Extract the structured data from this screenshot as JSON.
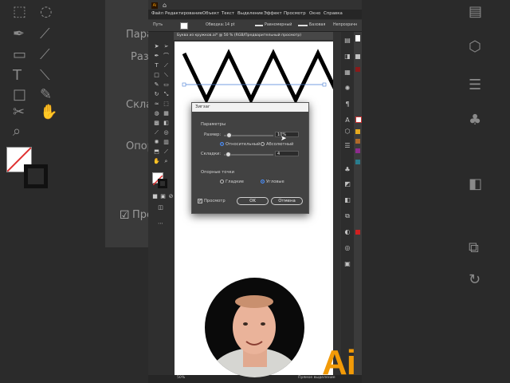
{
  "app": {
    "window_icon": "Ai"
  },
  "menubar": [
    "Файл",
    "Редактирование",
    "Объект",
    "Текст",
    "Выделение",
    "Эффект",
    "Просмотр",
    "Окно",
    "Справка"
  ],
  "control_bar": {
    "object_label": "Путь",
    "stroke_label": "Обводка:",
    "stroke_weight": "14 pt",
    "profile_label": "Равномерный",
    "brush_label": "Базовая",
    "opacity_label": "Непрозрачн"
  },
  "document_tab": "Буква из кружков.ai* @ 50 % (RGB/Предварительный просмотр)",
  "dialog": {
    "title": "Зигзаг",
    "params_label": "Параметры",
    "size_label": "Размер:",
    "size_value": "10%",
    "relative_label": "Относительный",
    "absolute_label": "Абсолютный",
    "ridges_label": "Складки:",
    "ridges_value": "4",
    "anchors_label": "Опорные точки",
    "smooth_label": "Гладкие",
    "corner_label": "Угловые",
    "preview_label": "Просмотр",
    "ok_label": "OK",
    "cancel_label": "Отмена",
    "size_slider": 0.1,
    "ridges_slider": 0.08,
    "relative_selected": true,
    "corner_selected": true,
    "preview_checked": true
  },
  "statusbar": {
    "zoom": "50%",
    "tool_name": "Прямое выделение"
  },
  "background_left": {
    "param": "Пара",
    "size": "Разм",
    "ridge": "Скла",
    "anchor": "Опор",
    "preview": "Пре"
  },
  "logo_text": "Ai",
  "colors": {
    "accent": "#4a90ff",
    "logo": "#f29a07"
  }
}
